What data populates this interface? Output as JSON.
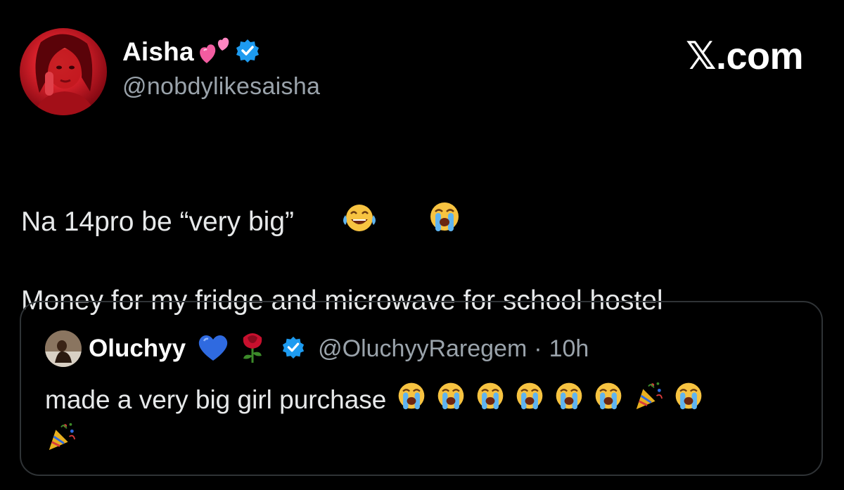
{
  "tweet": {
    "author": {
      "display_name": "Aisha",
      "name_emoji": "two-hearts-icon",
      "handle": "@nobdylikesaisha",
      "verified": true
    },
    "brand": "𝕏.com",
    "lines": [
      "Na 14pro be “very big”",
      "Money for my fridge and microwave for school hostel"
    ],
    "line1_emojis": [
      "joy-emoji",
      "sob-emoji"
    ]
  },
  "quote": {
    "display_name": "Oluchyy",
    "name_emojis": [
      "blue-heart-icon",
      "rose-icon"
    ],
    "verified": true,
    "handle": "@OluchyyRaregem",
    "separator": "·",
    "time": "10h",
    "text": "made a very big girl purchase",
    "trailing_emojis": [
      "sob-emoji",
      "sob-emoji",
      "sob-emoji",
      "sob-emoji",
      "sob-emoji",
      "sob-emoji",
      "party-popper-emoji",
      "sob-emoji",
      "party-popper-emoji"
    ]
  },
  "colors": {
    "background": "#000000",
    "text": "#e7e9ea",
    "secondary_text": "#9aa3ab",
    "verified_blue": "#1d9bf0",
    "card_border": "#2f3336"
  }
}
